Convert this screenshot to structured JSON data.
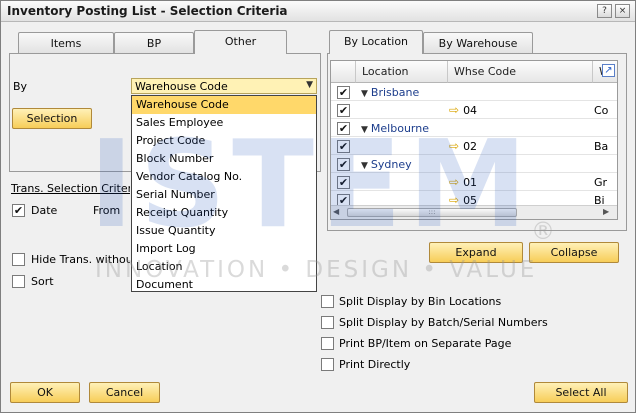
{
  "window": {
    "title": "Inventory Posting List - Selection Criteria",
    "controls": [
      "?",
      "×"
    ]
  },
  "left_tabs": [
    "Items",
    "BP",
    "Other"
  ],
  "by": {
    "label": "By",
    "selected": "Warehouse Code",
    "options": [
      "Warehouse Code",
      "Sales Employee",
      "Project Code",
      "Block Number",
      "Vendor Catalog No.",
      "Serial Number",
      "Receipt Quantity",
      "Issue Quantity",
      "Import Log",
      "Location",
      "Document"
    ]
  },
  "selection_button": "Selection",
  "trans_section": {
    "heading": "Trans. Selection Criteria",
    "date_label": "Date",
    "date_checked": true,
    "from_label": "From",
    "hide_label": "Hide Trans. without",
    "sort_label": "Sort"
  },
  "right_tabs": [
    "By Location",
    "By Warehouse"
  ],
  "grid": {
    "columns": [
      "Location",
      "Whse Code",
      "W"
    ],
    "rows": [
      {
        "type": "group",
        "location": "Brisbane",
        "checked": true
      },
      {
        "type": "item",
        "whse": "04",
        "extra": "Co",
        "checked": true
      },
      {
        "type": "group",
        "location": "Melbourne",
        "checked": true
      },
      {
        "type": "item",
        "whse": "02",
        "extra": "Ba",
        "checked": true
      },
      {
        "type": "group",
        "location": "Sydney",
        "checked": true
      },
      {
        "type": "item",
        "whse": "01",
        "extra": "Gr",
        "checked": true
      },
      {
        "type": "item",
        "whse": "05",
        "extra": "Bi",
        "checked": true
      }
    ]
  },
  "expand_button": "Expand",
  "collapse_button": "Collapse",
  "options": [
    {
      "label": "Split Display by Bin Locations",
      "checked": false
    },
    {
      "label": "Split Display by Batch/Serial Numbers",
      "checked": false
    },
    {
      "label": "Print BP/Item on Separate Page",
      "checked": false
    },
    {
      "label": "Print Directly",
      "checked": false
    }
  ],
  "footer": {
    "ok": "OK",
    "cancel": "Cancel",
    "select_all": "Select All"
  },
  "watermark": {
    "big": "ISTEM",
    "small": "INNOVATION • DESIGN • VALUE",
    "reg": "®"
  },
  "colors": {
    "button_yellow": "#f7cd59",
    "selected_item": "#ffd86a",
    "group_text": "#1c3d8c",
    "watermark_blue": "#285abe"
  }
}
